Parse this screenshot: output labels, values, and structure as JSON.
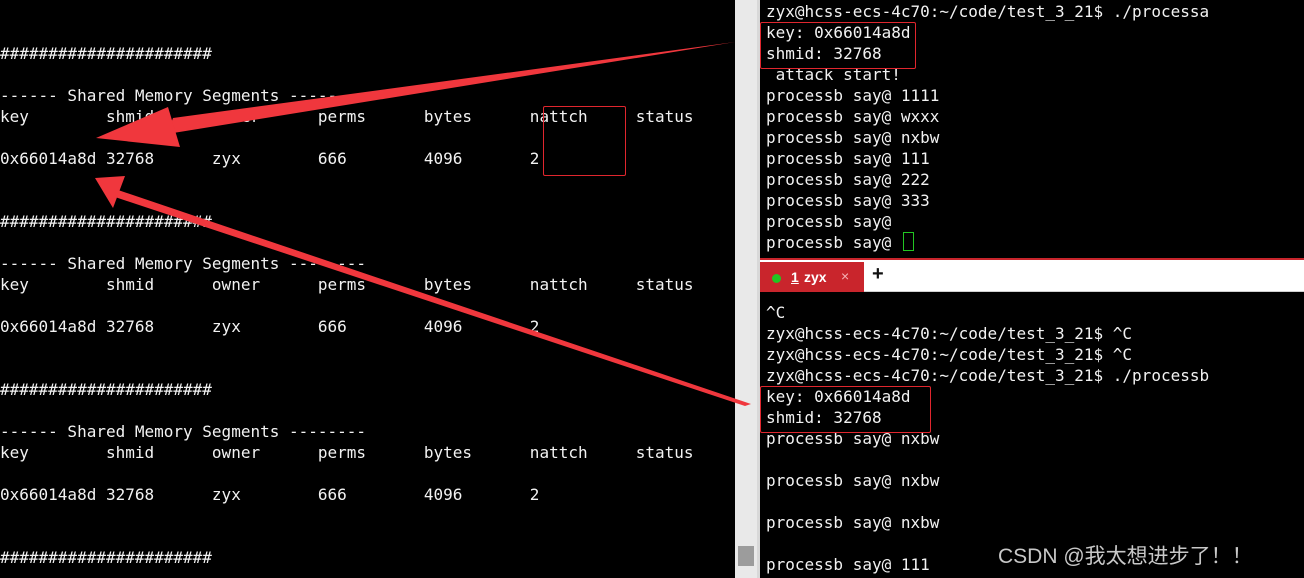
{
  "left_terminal": {
    "lines": [
      "######################",
      "------ Shared Memory Segments --------",
      "key        shmid      owner      perms      bytes      nattch     status",
      "0x66014a8d 32768      zyx        666        4096       2",
      "######################",
      "------ Shared Memory Segments --------",
      "key        shmid      owner      perms      bytes      nattch     status",
      "0x66014a8d 32768      zyx        666        4096       2",
      "######################",
      "------ Shared Memory Segments --------",
      "key        shmid      owner      perms      bytes      nattch     status",
      "0x66014a8d 32768      zyx        666        4096       2",
      "######################"
    ]
  },
  "right_top_terminal": {
    "lines": [
      "zyx@hcss-ecs-4c70:~/code/test_3_21$ ./processa",
      "key: 0x66014a8d",
      "shmid: 32768",
      " attack start!",
      "processb say@ 1111",
      "processb say@ wxxx",
      "processb say@ nxbw",
      "processb say@ 111",
      "processb say@ 222",
      "processb say@ 333",
      "processb say@ ",
      "processb say@ "
    ]
  },
  "tab_bar": {
    "active_tab": {
      "number": "1",
      "name": "zyx",
      "close": "×"
    },
    "new_tab": "+"
  },
  "right_bottom_terminal": {
    "lines": [
      "^C",
      "zyx@hcss-ecs-4c70:~/code/test_3_21$ ^C",
      "zyx@hcss-ecs-4c70:~/code/test_3_21$ ^C",
      "zyx@hcss-ecs-4c70:~/code/test_3_21$ ./processb",
      "key: 0x66014a8d",
      "shmid: 32768",
      "processb say@ nxbw",
      "processb say@ nxbw",
      "processb say@ nxbw",
      "processb say@ 111"
    ]
  },
  "watermark": "CSDN @我太想进步了！！",
  "colors": {
    "terminal_bg": "#000000",
    "terminal_text": "#f2f2f2",
    "highlight_red": "#e0262e",
    "arrow_red": "#f0373d",
    "tab_active": "#c9252c",
    "cursor_green": "#22c522"
  }
}
